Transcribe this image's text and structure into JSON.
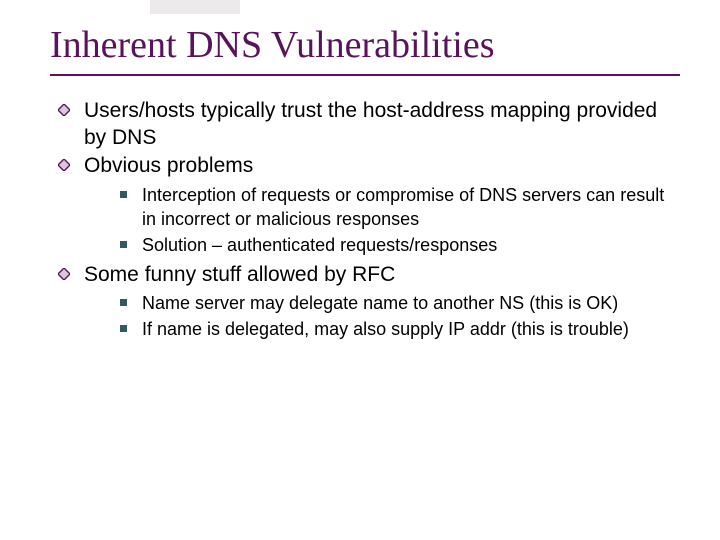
{
  "title": "Inherent DNS Vulnerabilities",
  "bullets": {
    "b0": "Users/hosts typically trust the host-address mapping provided by DNS",
    "b1": "Obvious problems",
    "b1_sub": {
      "s0": "Interception of requests or compromise of DNS servers can result in incorrect or malicious responses",
      "s1": "Solution – authenticated requests/responses"
    },
    "b2": "Some funny stuff allowed by RFC",
    "b2_sub": {
      "s0": "Name server may delegate name to another NS (this is OK)",
      "s1": "If name is delegated, may also supply IP addr  (this is trouble)"
    }
  }
}
